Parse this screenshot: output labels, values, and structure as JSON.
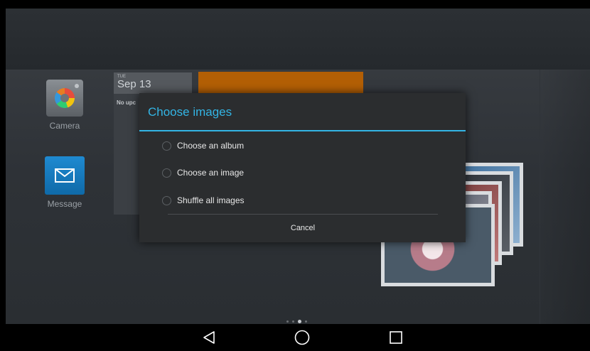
{
  "home": {
    "apps": [
      {
        "label": "Camera",
        "icon": "camera-icon"
      },
      {
        "label": "Message",
        "icon": "envelope-icon"
      }
    ],
    "calendar": {
      "day_of_week": "TUE",
      "date": "Sep 13",
      "body_text": "No upc"
    },
    "page_indicator": {
      "count": 4,
      "active_index": 2
    }
  },
  "dialog": {
    "title": "Choose images",
    "options": [
      {
        "label": "Choose an album",
        "selected": false
      },
      {
        "label": "Choose an image",
        "selected": false
      },
      {
        "label": "Shuffle all images",
        "selected": false
      }
    ],
    "cancel_label": "Cancel"
  },
  "navbar": {
    "icons": [
      "back-icon",
      "home-icon",
      "recent-apps-icon"
    ]
  },
  "colors": {
    "accent": "#33b5e5",
    "dialog_bg": "#2b2d2f",
    "orange_widget": "#b35f05",
    "message_blue": "#1a7fc4"
  }
}
